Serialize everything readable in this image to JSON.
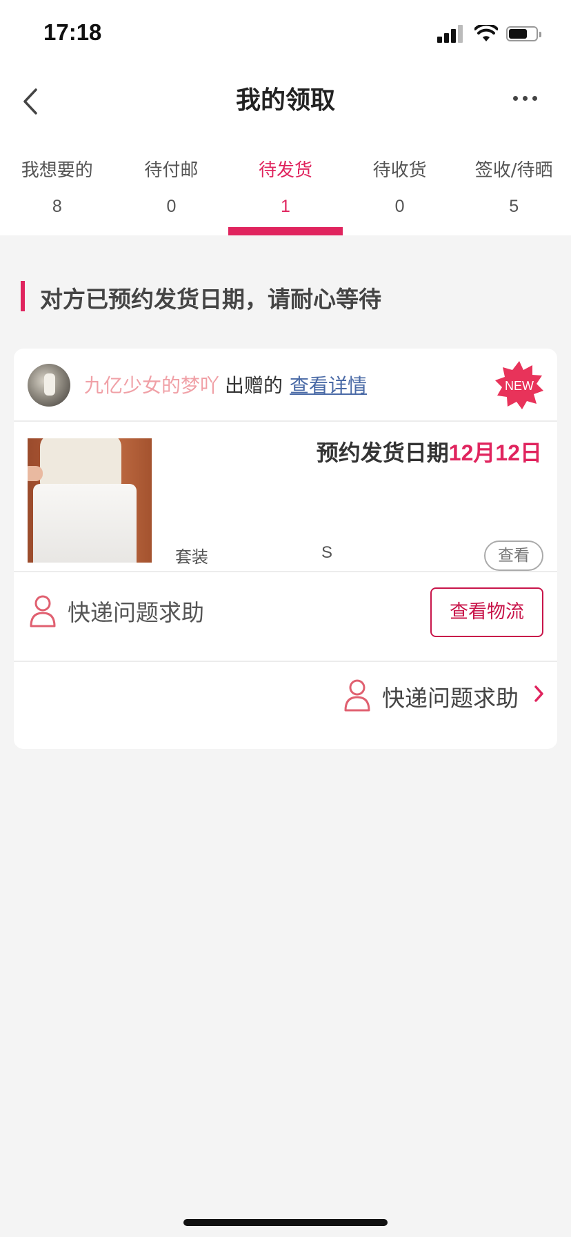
{
  "status_bar": {
    "time": "17:18"
  },
  "nav": {
    "title": "我的领取"
  },
  "tabs": [
    {
      "label": "我想要的",
      "count": "8"
    },
    {
      "label": "待付邮",
      "count": "0"
    },
    {
      "label": "待发货",
      "count": "1",
      "active": true
    },
    {
      "label": "待收货",
      "count": "0"
    },
    {
      "label": "签收/待晒",
      "count": "5"
    }
  ],
  "notice": {
    "text": "对方已预约发货日期，请耐心等待"
  },
  "card": {
    "giver_name": "九亿少女的梦吖",
    "giver_suffix": "出赠的",
    "detail_link": "查看详情",
    "badge": "NEW",
    "ship_date_label": "预约发货日期",
    "ship_date_value": "12月12日",
    "product_type": "套装",
    "product_size": "S",
    "view_button": "查看",
    "help_text": "快递问题求助",
    "logistics_button": "查看物流",
    "help_link": "快递问题求助"
  },
  "colors": {
    "accent": "#e0245e",
    "link": "#4a6aa6",
    "giver": "#f0a0a6"
  }
}
